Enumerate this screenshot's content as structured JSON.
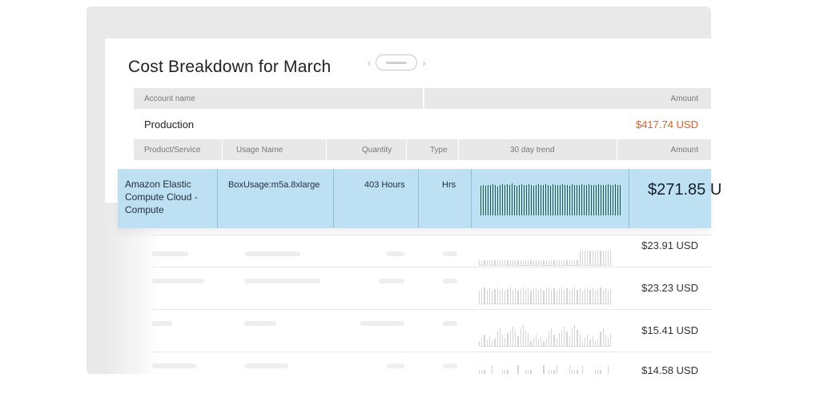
{
  "page": {
    "title": "Cost Breakdown for March",
    "pager_prev": "‹",
    "pager_next": "›"
  },
  "account_header": {
    "account_name": "Account name",
    "amount": "Amount"
  },
  "account": {
    "name": "Production",
    "amount": "$417.74 USD"
  },
  "columns": {
    "product_service": "Product/Service",
    "usage_name": "Usage Name",
    "quantity": "Quantity",
    "type": "Type",
    "trend": "30 day trend",
    "amount": "Amount"
  },
  "selected_row": {
    "product": "Amazon Elastic Compute Cloud - Compute",
    "usage_name": "BoxUsage:m5a.8xlarge",
    "quantity": "403 Hours",
    "type": "Hrs",
    "amount": "$271.85 U",
    "trend_values": [
      0.92,
      0.95,
      0.93,
      0.96,
      0.94,
      0.97,
      0.95,
      0.9,
      0.96,
      0.98,
      0.94,
      0.97,
      0.95,
      0.99,
      0.96,
      0.93,
      0.95,
      0.97,
      0.94,
      0.96,
      0.98,
      0.95,
      0.93,
      0.96,
      0.97,
      0.95,
      0.94,
      0.98,
      0.96,
      0.93,
      0.97,
      0.95,
      0.96,
      0.94,
      0.97,
      0.95,
      0.96,
      0.93,
      0.98,
      0.95,
      0.96,
      0.94,
      0.97,
      0.95,
      0.96,
      0.98,
      0.94,
      0.96,
      0.95,
      0.97,
      0.95,
      0.96,
      0.94,
      0.97,
      0.96,
      0.95,
      0.98,
      0.94,
      0.96
    ]
  },
  "other_rows": [
    {
      "amount": "$23.91 USD"
    },
    {
      "amount": "$23.23 USD"
    },
    {
      "amount": "$15.41 USD"
    },
    {
      "amount": "$14.58 USD"
    }
  ],
  "colors": {
    "accent": "#ef5a1f",
    "selection": "#bde0f3",
    "trend_bar": "#1f5a46"
  }
}
